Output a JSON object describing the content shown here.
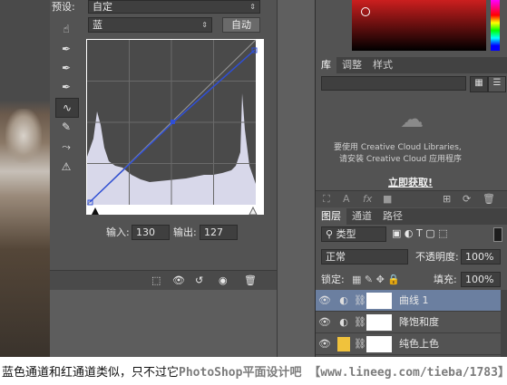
{
  "properties": {
    "preset_label": "预设:",
    "preset_value": "自定",
    "channel_value": "蓝",
    "auto_button": "自动",
    "input_label": "输入:",
    "input_value": "130",
    "output_label": "输出:",
    "output_value": "127"
  },
  "color_panel": {
    "tabs": [
      "库",
      "调整",
      "样式"
    ]
  },
  "library": {
    "message_line1": "要使用 Creative Cloud Libraries,",
    "message_line2": "请安装 Creative Cloud 应用程序",
    "link": "立即获取!"
  },
  "layers": {
    "tabs": [
      "图层",
      "通道",
      "路径"
    ],
    "filter_kind": "类型",
    "blend_mode": "正常",
    "opacity_label": "不透明度:",
    "opacity_value": "100%",
    "lock_label": "锁定:",
    "fill_label": "填充:",
    "fill_value": "100%",
    "items": [
      {
        "name": "曲线 1"
      },
      {
        "name": "降饱和度"
      },
      {
        "name": "纯色上色"
      }
    ]
  },
  "caption": {
    "text": "蓝色通道和红通道类似，只不过它",
    "watermark": "PhotoShop平面设计吧 【www.lineeg.com/tieba/1783】"
  },
  "colors": {
    "accent": "#2f4fd6",
    "histogram": "#d8d8ea",
    "selected_row": "#6b7fa0"
  }
}
